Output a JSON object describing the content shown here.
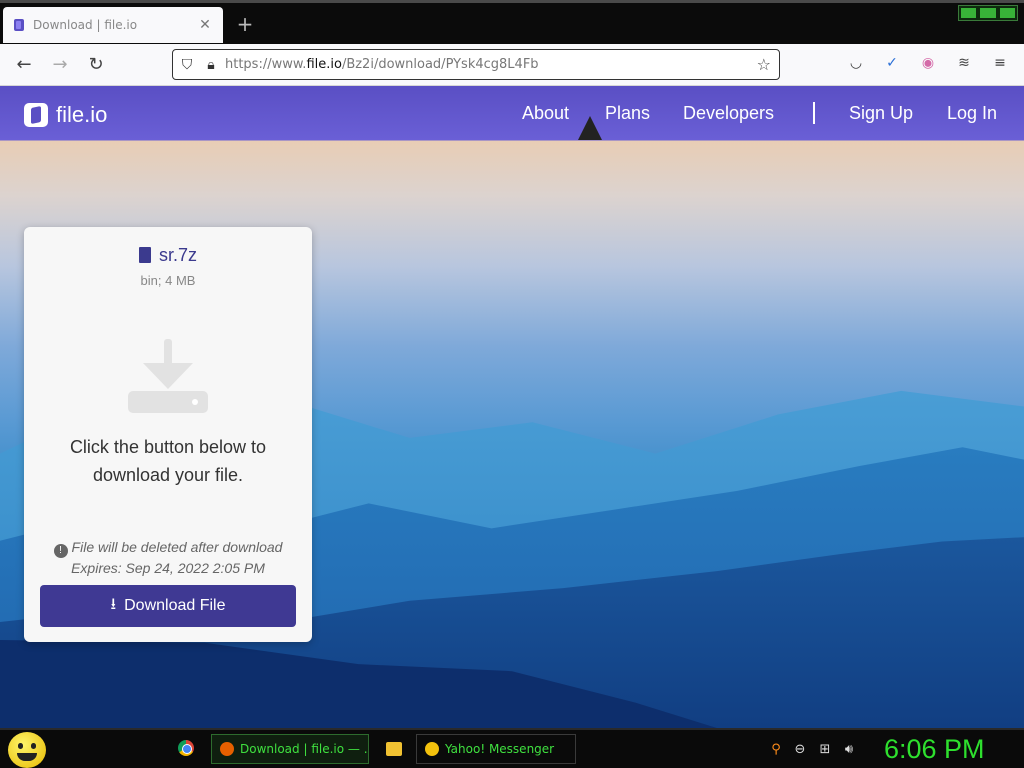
{
  "browser": {
    "tab_title": "Download | file.io",
    "tab_close": "✕",
    "new_tab": "+",
    "url_prefix": "https://www.",
    "url_host": "file.io",
    "url_path": "/Bz2i/download/PYsk4cg8L4Fb"
  },
  "site": {
    "brand": "file.io",
    "nav": {
      "about": "About",
      "plans": "Plans",
      "developers": "Developers",
      "signup": "Sign Up",
      "login": "Log In"
    }
  },
  "card": {
    "file_name": "sr.7z",
    "file_meta": "bin; 4 MB",
    "instruction": "Click the button below to download your file.",
    "note_line1": "File will be deleted after download",
    "note_line2": "Expires: Sep 24, 2022 2:05 PM",
    "download_label": "Download File"
  },
  "taskbar": {
    "firefox_item": "Download | file.io — ...",
    "yahoo_item": "Yahoo! Messenger",
    "clock": "6:06 PM"
  },
  "colors": {
    "brand_purple": "#5a4fc4",
    "button": "#3f3993",
    "clock_green": "#2ee02e"
  }
}
